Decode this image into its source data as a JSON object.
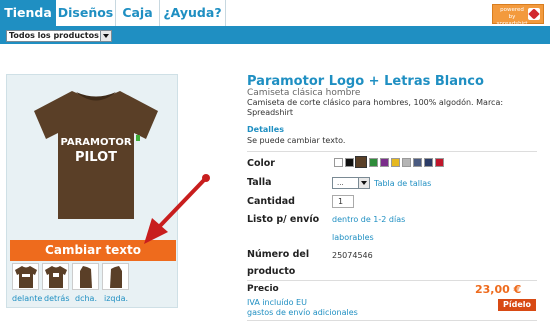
{
  "nav": {
    "tabs": [
      {
        "label": "Tienda",
        "active": true
      },
      {
        "label": "Diseños",
        "active": false
      },
      {
        "label": "Caja",
        "active": false
      },
      {
        "label": "¿Ayuda?",
        "active": false
      }
    ],
    "brand_text": "powered by spreadshirt"
  },
  "filter": {
    "selected": "Todos los productos"
  },
  "product": {
    "title": "Paramotor Logo + Letras Blanco",
    "subtitle": "Camiseta clásica hombre",
    "description": "Camiseta de corte clásico para hombres, 100% algodón. Marca: Spreadshirt",
    "details_heading": "Detalles",
    "details_text": "Se puede cambiar texto.",
    "shirt_print": [
      "PARAMOTOR",
      "PILOT"
    ]
  },
  "left": {
    "change_text_button": "Cambiar texto",
    "thumbs": [
      "delante",
      "detrás",
      "dcha.",
      "izqda."
    ]
  },
  "options": {
    "color_label": "Color",
    "swatches": [
      "#ffffff",
      "#111111",
      "#5a4028",
      "#2e8b3a",
      "#7a2d8a",
      "#e5b820",
      "#b5b5b5",
      "#4a5a80",
      "#2b3b66",
      "#c0162b"
    ],
    "size_label": "Talla",
    "size_value": "...",
    "size_table_link": "Tabla de tallas",
    "qty_label": "Cantidad",
    "qty_value": "1",
    "ship_label": "Listo p/ envío",
    "ship_value_1": "dentro de 1-2 días",
    "ship_value_2": "laborables",
    "number_label_1": "Número del",
    "number_label_2": "producto",
    "number_value": "25074546",
    "price_label": "Precio",
    "price_value": "23,00 €",
    "vat": "IVA incluído EU",
    "shipping": "gastos de envío adicionales",
    "order_button": "Pídelo"
  }
}
